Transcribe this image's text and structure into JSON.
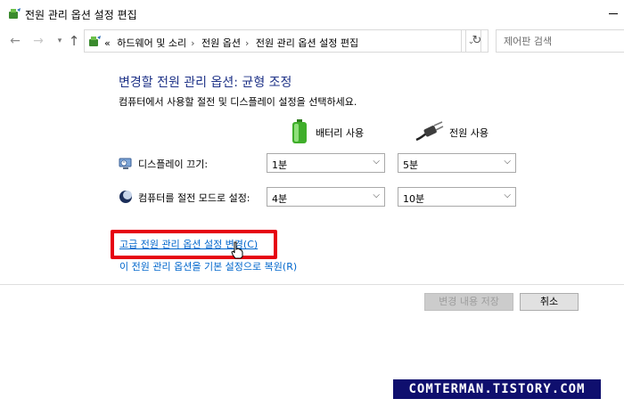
{
  "window": {
    "title": "전원 관리 옵션 설정 편집",
    "icon": "power-options-icon"
  },
  "navigation": {
    "back_icon": "arrow-left-icon",
    "forward_icon": "arrow-right-icon",
    "recent_icon": "chevron-down-icon",
    "up_icon": "arrow-up-icon",
    "breadcrumb_prefix": "«",
    "breadcrumbs": [
      "하드웨어 및 소리",
      "전원 옵션",
      "전원 관리 옵션 설정 편집"
    ],
    "separator": "›",
    "refresh_icon": "refresh-icon",
    "search_placeholder": "제어판 검색"
  },
  "main": {
    "heading": "변경할 전원 관리 옵션: 균형 조정",
    "subheading": "컴퓨터에서 사용할 절전 및 디스플레이 설정을 선택하세요.",
    "columns": {
      "battery": "배터리 사용",
      "plugged_in": "전원 사용"
    },
    "settings": [
      {
        "label": "디스플레이 끄기:",
        "battery_value": "1분",
        "plugged_value": "5분"
      },
      {
        "label": "컴퓨터를 절전 모드로 설정:",
        "battery_value": "4분",
        "plugged_value": "10분"
      }
    ],
    "links": {
      "advanced": "고급 전원 관리 옵션 설정 변경(C)",
      "restore": "이 전원 관리 옵션을 기본 설정으로 복원(R)"
    },
    "buttons": {
      "save": "변경 내용 저장",
      "cancel": "취소"
    }
  },
  "watermark": "COMTERMAN.TISTORY.COM",
  "colors": {
    "heading": "#1e3287",
    "link": "#0066cc",
    "highlight": "#e60012",
    "watermark_bg": "#0f0f6e"
  }
}
